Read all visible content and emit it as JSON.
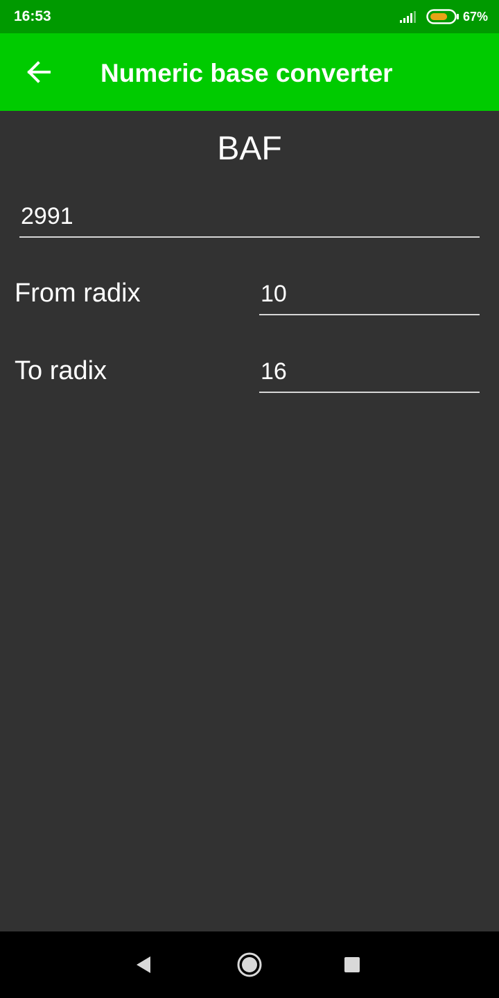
{
  "status_bar": {
    "time": "16:53",
    "battery_percent": "67%",
    "battery_level": 0.67,
    "icons": [
      "signal-icon",
      "battery-icon"
    ]
  },
  "app_bar": {
    "title": "Numeric base converter",
    "back_icon": "arrow-left-icon"
  },
  "converter": {
    "result": "BAF",
    "number_value": "2991",
    "from_label": "From radix",
    "from_value": "10",
    "to_label": "To radix",
    "to_value": "16"
  },
  "nav_bar": {
    "icons": [
      "nav-back-icon",
      "nav-home-icon",
      "nav-recents-icon"
    ]
  },
  "colors": {
    "status_bar": "#009a00",
    "app_bar": "#00cb00",
    "background": "#323232",
    "battery_fill": "#e8a317",
    "underline": "#d7d7d7"
  }
}
